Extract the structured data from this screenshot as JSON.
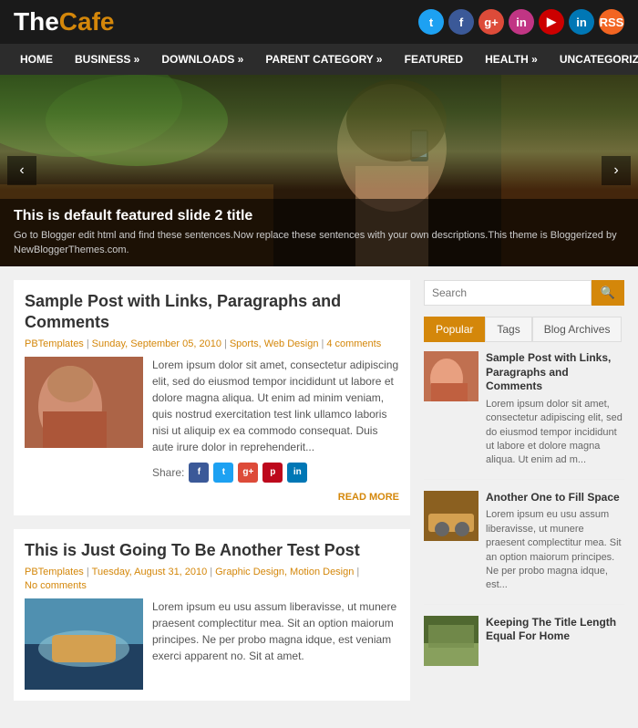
{
  "header": {
    "logo_the": "The",
    "logo_cafe": "Cafe"
  },
  "nav": {
    "items": [
      {
        "label": "HOME"
      },
      {
        "label": "BUSINESS »"
      },
      {
        "label": "DOWNLOADS »"
      },
      {
        "label": "PARENT CATEGORY »"
      },
      {
        "label": "FEATURED"
      },
      {
        "label": "HEALTH »"
      },
      {
        "label": "UNCATEGORIZED"
      }
    ]
  },
  "slider": {
    "title": "This is default featured slide 2 title",
    "desc": "Go to Blogger edit html and find these sentences.Now replace these sentences with your own descriptions.This theme is Bloggerized by NewBloggerThemes.com.",
    "btn_left": "‹",
    "btn_right": "›"
  },
  "posts": [
    {
      "title": "Sample Post with Links, Paragraphs and Comments",
      "meta_author": "PBTemplates",
      "meta_date": "Sunday, September 05, 2010",
      "meta_tags": "Sports, Web Design",
      "meta_comments": "4 comments",
      "text": "Lorem ipsum dolor sit amet, consectetur adipiscing elit, sed do eiusmod tempor incididunt ut labore et dolore magna aliqua. Ut enim ad minim veniam, quis nostrud exercitation test link ullamco laboris nisi ut aliquip ex ea commodo consequat. Duis aute irure dolor in reprehenderit...",
      "share_label": "Share:",
      "read_more": "READ MORE"
    },
    {
      "title": "This is Just Going To Be Another Test Post",
      "meta_author": "PBTemplates",
      "meta_date": "Tuesday, August 31, 2010",
      "meta_tags": "Graphic Design, Motion Design",
      "meta_comments": "No comments",
      "text": "Lorem ipsum eu usu assum liberavisse, ut munere praesent complectitur mea. Sit an option maiorum principes. Ne per probo magna idque, est veniam exerci apparent no. Sit at amet.",
      "share_label": "",
      "read_more": ""
    }
  ],
  "sidebar": {
    "search_placeholder": "Search",
    "search_btn": "🔍",
    "tabs": [
      "Popular",
      "Tags",
      "Blog Archives"
    ],
    "active_tab": 0,
    "sidebar_posts": [
      {
        "title": "Sample Post with Links, Paragraphs and Comments",
        "text": "Lorem ipsum dolor sit amet, consectetur adipiscing elit, sed do eiusmod tempor incididunt ut labore et dolore magna aliqua. Ut enim ad m..."
      },
      {
        "title": "Another One to Fill Space",
        "text": "Lorem ipsum eu usu assum liberavisse, ut munere praesent complectitur mea. Sit an option maiorum principes. Ne per probo magna idque, est..."
      },
      {
        "title": "Keeping The Title Length Equal For Home",
        "text": ""
      }
    ]
  },
  "social": {
    "twitter": "t",
    "facebook": "f",
    "gplus": "g+",
    "instagram": "in",
    "youtube": "▶",
    "linkedin": "in",
    "rss": "RSS"
  }
}
